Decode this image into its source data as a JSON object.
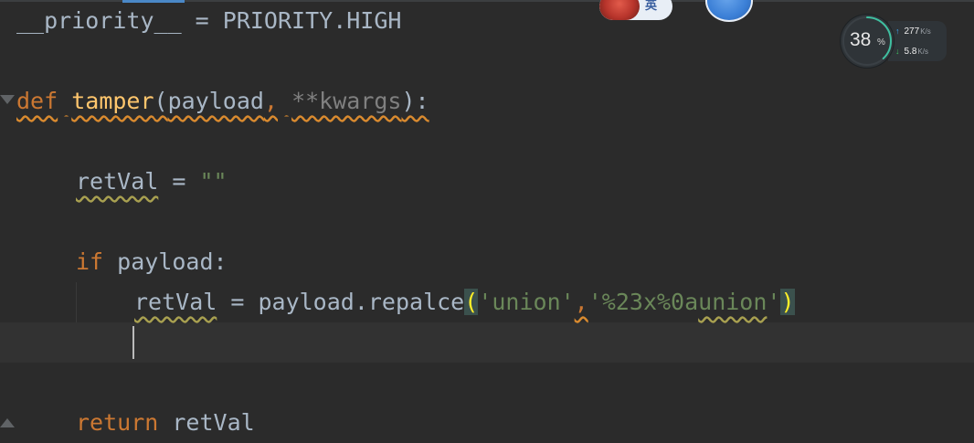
{
  "editor": {
    "lines": {
      "priority": {
        "dunder": "__priority__",
        "assign": " = ",
        "value": "PRIORITY.HIGH"
      },
      "def": {
        "keyword": "def",
        "space": " ",
        "name": "tamper",
        "open": "(",
        "param1": "payload",
        "comma": ",",
        "space2": " ",
        "param2": "**kwargs",
        "close": "):"
      },
      "retval_init": {
        "name": "retVal",
        "assign": " = ",
        "value": "\"\""
      },
      "if": {
        "keyword": "if",
        "space": " ",
        "cond": "payload:"
      },
      "replace": {
        "name": "retVal",
        "assign": " = ",
        "call": "payload.repalce",
        "open": "(",
        "arg1": "'union'",
        "comma": ",",
        "arg2_pre": "'%23x%0a",
        "arg2_union": "union",
        "arg2_post": "'",
        "close": ")"
      },
      "return": {
        "keyword": "return",
        "space": " ",
        "value": "retVal"
      }
    }
  },
  "overlay": {
    "input_method": {
      "lang_label": "英"
    },
    "net_monitor": {
      "cpu_percent": "38",
      "cpu_unit": "%",
      "cpu_fraction": 0.38,
      "upload": "277",
      "upload_unit": "K/s",
      "download": "5.8",
      "download_unit": "K/s",
      "arrow_up": "↑",
      "arrow_down": "↓"
    }
  },
  "colors": {
    "background": "#2b2b2b",
    "keyword": "#cc7832",
    "function": "#ffc66d",
    "string": "#6a8759",
    "identifier": "#a9b7c6",
    "gauge_arc": "#3fbfa0"
  }
}
